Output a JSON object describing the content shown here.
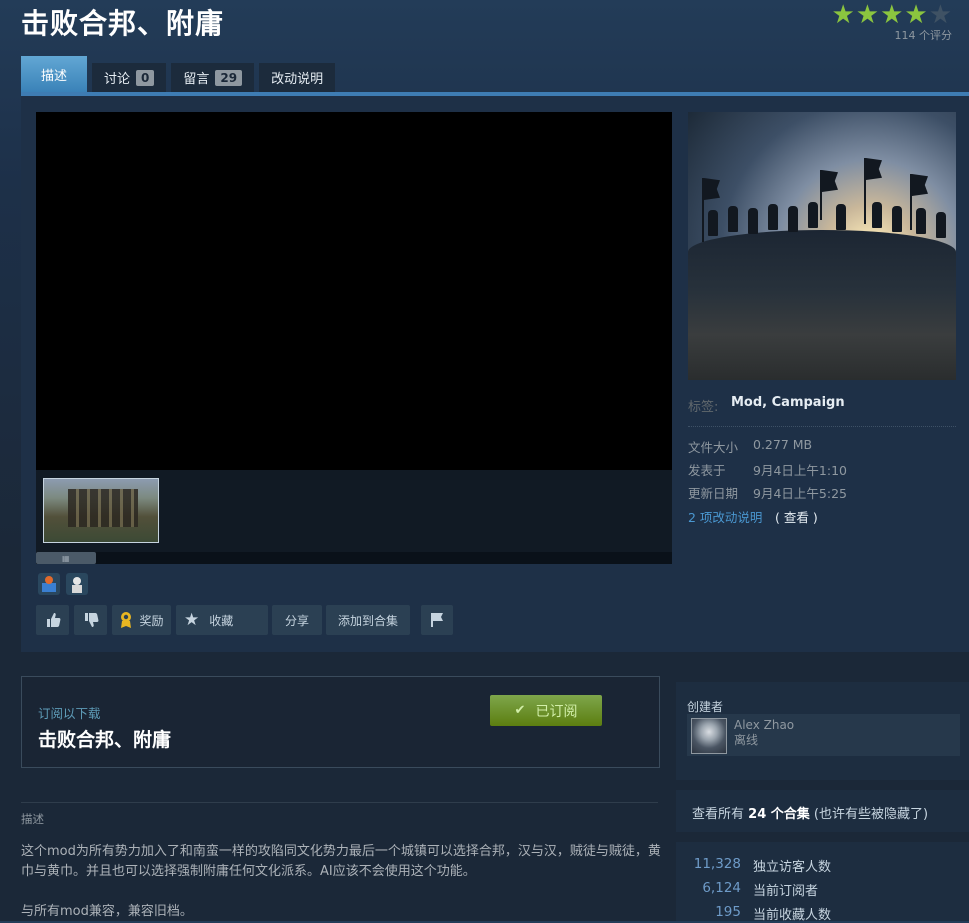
{
  "header": {
    "title": "击败合邦、附庸",
    "rating": {
      "stars_filled": 4,
      "stars_total": 5,
      "count_text": "114 个评分"
    }
  },
  "tabs": [
    {
      "label": "描述",
      "count": null
    },
    {
      "label": "讨论",
      "count": "0"
    },
    {
      "label": "留言",
      "count": "29"
    },
    {
      "label": "改动说明",
      "count": null
    }
  ],
  "details": {
    "tags_label": "标签:",
    "tags_value": "Mod, Campaign",
    "file_size_label": "文件大小",
    "file_size": "0.277 MB",
    "posted_label": "发表于",
    "posted": "9月4日上午1:10",
    "updated_label": "更新日期",
    "updated": "9月4日上午5:25",
    "changelog_link": "2 项改动说明",
    "changelog_view": "( 查看 )"
  },
  "actions": {
    "award": "奖励",
    "favorite": "收藏",
    "share": "分享",
    "add_to_collection": "添加到合集"
  },
  "subscribe": {
    "small_label": "订阅以下载",
    "title": "击败合邦、附庸",
    "button": "已订阅"
  },
  "description": {
    "heading": "描述",
    "para1": "这个mod为所有势力加入了和南蛮一样的攻陷同文化势力最后一个城镇可以选择合邦，汉与汉，贼徒与贼徒，黄巾与黄巾。并且也可以选择强制附庸任何文化派系。AI应该不会使用这个功能。",
    "para2": "与所有mod兼容，兼容旧档。"
  },
  "creator": {
    "heading": "创建者",
    "name": "Alex Zhao",
    "status": "离线"
  },
  "collections": {
    "prefix": "查看所有",
    "count": "24 个合集",
    "suffix": "(也许有些被隐藏了)"
  },
  "stats": [
    {
      "value": "11,328",
      "label": "独立访客人数"
    },
    {
      "value": "6,124",
      "label": "当前订阅者"
    },
    {
      "value": "195",
      "label": "当前收藏人数"
    }
  ],
  "colors": {
    "accent": "#3e7cb3",
    "star": "#8bc53f",
    "subscribed": "#7ea64b"
  }
}
